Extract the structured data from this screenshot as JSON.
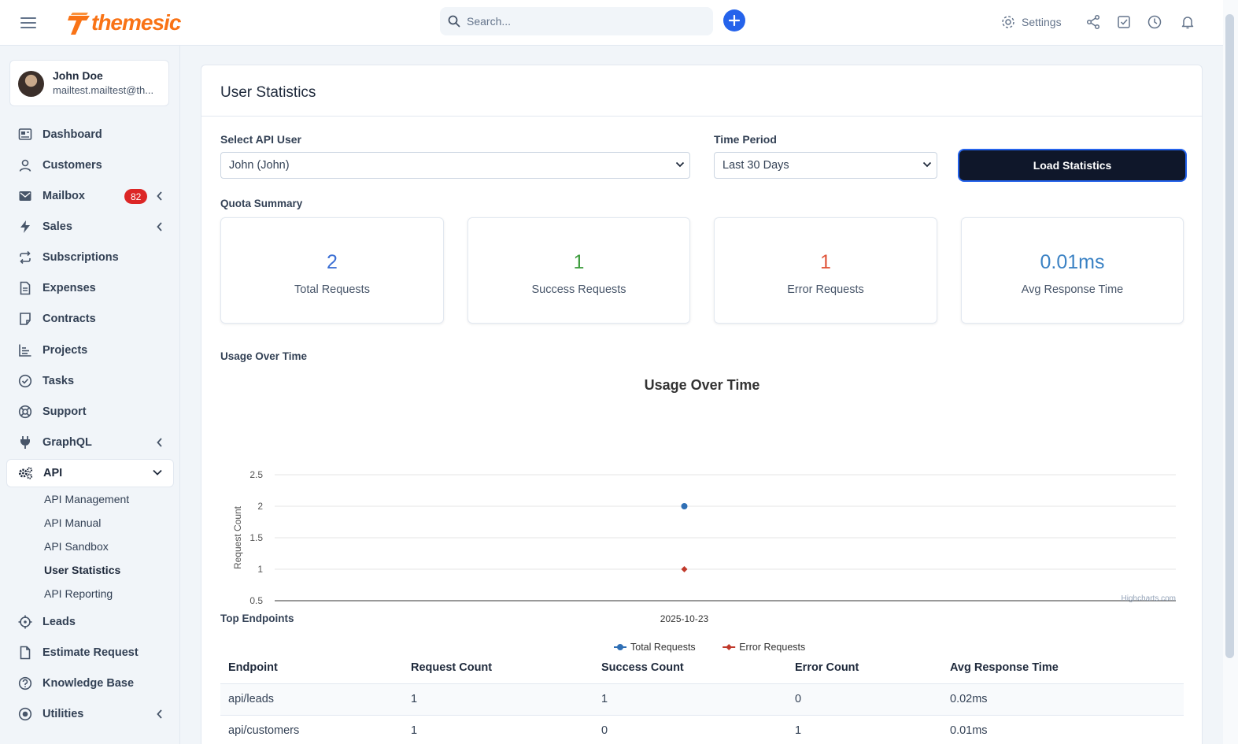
{
  "topbar": {
    "logo_text": "themesic",
    "search_placeholder": "Search...",
    "settings_label": "Settings"
  },
  "profile": {
    "name": "John Doe",
    "email": "mailtest.mailtest@th..."
  },
  "sidebar": {
    "items": [
      {
        "label": "Dashboard",
        "icon": "dashboard-icon"
      },
      {
        "label": "Customers",
        "icon": "user-icon"
      },
      {
        "label": "Mailbox",
        "icon": "mail-icon",
        "badge": "82"
      },
      {
        "label": "Sales",
        "icon": "bolt-icon"
      },
      {
        "label": "Subscriptions",
        "icon": "repeat-icon"
      },
      {
        "label": "Expenses",
        "icon": "file-icon"
      },
      {
        "label": "Contracts",
        "icon": "contract-icon"
      },
      {
        "label": "Projects",
        "icon": "chart-icon"
      },
      {
        "label": "Tasks",
        "icon": "check-circle-icon"
      },
      {
        "label": "Support",
        "icon": "lifebuoy-icon"
      },
      {
        "label": "GraphQL",
        "icon": "plug-icon"
      },
      {
        "label": "API",
        "icon": "gears-icon"
      },
      {
        "label": "Leads",
        "icon": "crosshair-icon"
      },
      {
        "label": "Estimate Request",
        "icon": "document-icon"
      },
      {
        "label": "Knowledge Base",
        "icon": "question-circle-icon"
      },
      {
        "label": "Utilities",
        "icon": "dot-circle-icon"
      }
    ],
    "api_sub": [
      "API Management",
      "API Manual",
      "API Sandbox",
      "User Statistics",
      "API Reporting"
    ]
  },
  "main": {
    "title": "User Statistics",
    "api_user_label": "Select API User",
    "api_user_value": "John (John)",
    "period_label": "Time Period",
    "period_value": "Last 30 Days",
    "load_button": "Load Statistics",
    "quota_label": "Quota Summary",
    "stats": [
      {
        "value": "2",
        "label": "Total Requests",
        "color": "#3b6fd4"
      },
      {
        "value": "1",
        "label": "Success Requests",
        "color": "#3f9d3f"
      },
      {
        "value": "1",
        "label": "Error Requests",
        "color": "#e0553a"
      },
      {
        "value": "0.01ms",
        "label": "Avg Response Time",
        "color": "#3b82c4"
      }
    ],
    "usage_label": "Usage Over Time",
    "top_endpoints_label": "Top Endpoints",
    "chart_credit": "Highcharts.com"
  },
  "chart_data": {
    "type": "line",
    "title": "Usage Over Time",
    "ylabel": "Request Count",
    "xlabel": "",
    "x": [
      "2025-10-23"
    ],
    "ylim": [
      0.5,
      2.5
    ],
    "yticks": [
      "0.5",
      "1",
      "1.5",
      "2",
      "2.5"
    ],
    "series": [
      {
        "name": "Total Requests",
        "values": [
          2
        ],
        "color": "#2f6fb5",
        "marker": "circle"
      },
      {
        "name": "Error Requests",
        "values": [
          1
        ],
        "color": "#c0392b",
        "marker": "diamond"
      }
    ],
    "legend": "bottom-center",
    "grid": true
  },
  "table": {
    "headers": [
      "Endpoint",
      "Request Count",
      "Success Count",
      "Error Count",
      "Avg Response Time"
    ],
    "rows": [
      [
        "api/leads",
        "1",
        "1",
        "0",
        "0.02ms"
      ],
      [
        "api/customers",
        "1",
        "0",
        "1",
        "0.01ms"
      ]
    ]
  }
}
